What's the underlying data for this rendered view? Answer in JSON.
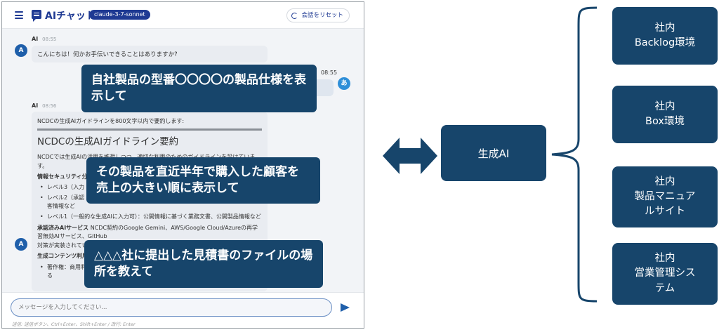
{
  "chat": {
    "app_title": "AIチャット",
    "model_badge": "claude-3-7-sonnet",
    "reset_label": "会話をリセット",
    "messages": [
      {
        "sender": "AI",
        "time": "08:55",
        "avatar": "A",
        "text": "こんにちは！何かお手伝いできることはありますか?"
      },
      {
        "sender": "あ",
        "time": "08:55",
        "avatar": "あ"
      },
      {
        "sender": "AI",
        "time": "08:56",
        "avatar": "A",
        "prompt_echo": "NCDCの生成AIガイドラインを800文字以内で要約します:",
        "heading": "NCDCの生成AIガイドライン要約",
        "intro": "NCDCでは生成AIの活用を推奨しつつ、適切な利用のためのガイドラインを設けています。",
        "section1": "情報セキュリティ分",
        "bullets1": [
          "レベル3（入力",
          "レベル2（承認",
          "客情報など",
          "レベル1（一般的な生成AIに入力可）：公開情報に基づく業務文書、公開製品情報など"
        ],
        "section2_title": "承認済みAIサービス",
        "section2_text": "NCDC契約のGoogle Gemini、AWS/Google Cloud/Azureの再学習無効AIサービス、GitHub",
        "section2_text2": "対策が実装されてい",
        "section3": "生成コンテンツ利用",
        "bullets3": [
          "著作権：商用利",
          "る"
        ]
      }
    ],
    "input_placeholder": "メッセージを入力してください...",
    "input_hint": "送信: 送信ボタン、Ctrl+Enter、Shift+Enter / 改行: Enter"
  },
  "callouts": [
    "自社製品の型番〇〇〇〇の製品仕様を表示して",
    "その製品を直近半年で購入した顧客を売上の大きい順に表示して",
    "△△△社に提出した見積書のファイルの場所を教えて"
  ],
  "diagram": {
    "center_label": "生成AI",
    "systems": [
      {
        "line1": "社内",
        "line2": "Backlog環境"
      },
      {
        "line1": "社内",
        "line2": "Box環境"
      },
      {
        "line1": "社内",
        "line2": "製品マニュア",
        "line3": "ルサイト"
      },
      {
        "line1": "社内",
        "line2": "営業管理シス",
        "line3": "テム"
      }
    ]
  },
  "colors": {
    "accent": "#1f3a93",
    "box": "#17456b"
  }
}
